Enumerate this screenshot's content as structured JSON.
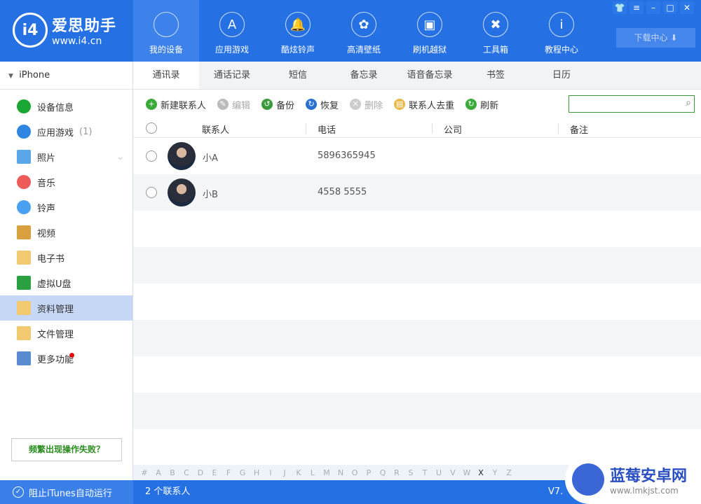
{
  "app": {
    "logo_name": "爱思助手",
    "logo_url": "www.i4.cn"
  },
  "nav": [
    {
      "label": "我的设备",
      "icon": "apple-icon"
    },
    {
      "label": "应用游戏",
      "icon": "app-store-icon"
    },
    {
      "label": "酷炫铃声",
      "icon": "bell-icon"
    },
    {
      "label": "高清壁纸",
      "icon": "flower-icon"
    },
    {
      "label": "刷机越狱",
      "icon": "box-icon"
    },
    {
      "label": "工具箱",
      "icon": "tools-icon"
    },
    {
      "label": "教程中心",
      "icon": "info-icon"
    }
  ],
  "download_center": "下载中心",
  "device": "iPhone",
  "sidebar": [
    {
      "label": "设备信息",
      "color": "#1aa632"
    },
    {
      "label": "应用游戏",
      "count": "(1)",
      "color": "#2e86e0"
    },
    {
      "label": "照片",
      "color": "#5aa8e8"
    },
    {
      "label": "音乐",
      "color": "#ee5a5a"
    },
    {
      "label": "铃声",
      "color": "#4aa0f0"
    },
    {
      "label": "视频",
      "color": "#d9a040"
    },
    {
      "label": "电子书",
      "color": "#f2c870"
    },
    {
      "label": "虚拟U盘",
      "color": "#2aa040"
    },
    {
      "label": "资料管理",
      "color": "#f2c870"
    },
    {
      "label": "文件管理",
      "color": "#f2c870"
    },
    {
      "label": "更多功能",
      "color": "#5a8ad0"
    }
  ],
  "fail_button": "频繁出现操作失败？",
  "tabs": [
    "通讯录",
    "通话记录",
    "短信",
    "备忘录",
    "语音备忘录",
    "书签",
    "日历"
  ],
  "toolbar": [
    {
      "label": "新建联系人",
      "enabled": true
    },
    {
      "label": "编辑",
      "enabled": false
    },
    {
      "label": "备份",
      "enabled": true
    },
    {
      "label": "恢复",
      "enabled": true
    },
    {
      "label": "删除",
      "enabled": false
    },
    {
      "label": "联系人去重",
      "enabled": true
    },
    {
      "label": "刷新",
      "enabled": true
    }
  ],
  "search": {
    "placeholder": "",
    "value": ""
  },
  "columns": [
    "联系人",
    "电话",
    "公司",
    "备注"
  ],
  "contacts": [
    {
      "name": "小A",
      "phone": "5896365945"
    },
    {
      "name": "小B",
      "phone": "4558 5555"
    }
  ],
  "alphabet": [
    "#",
    "A",
    "B",
    "C",
    "D",
    "E",
    "F",
    "G",
    "H",
    "I",
    "J",
    "K",
    "L",
    "M",
    "N",
    "O",
    "P",
    "Q",
    "R",
    "S",
    "T",
    "U",
    "V",
    "W",
    "X",
    "Y",
    "Z"
  ],
  "alphabet_active": "X",
  "status": {
    "itunes": "阻止iTunes自动运行",
    "count": "2 个联系人",
    "version": "V7."
  },
  "watermark": {
    "name": "蓝莓安卓网",
    "url": "www.lmkjst.com"
  }
}
